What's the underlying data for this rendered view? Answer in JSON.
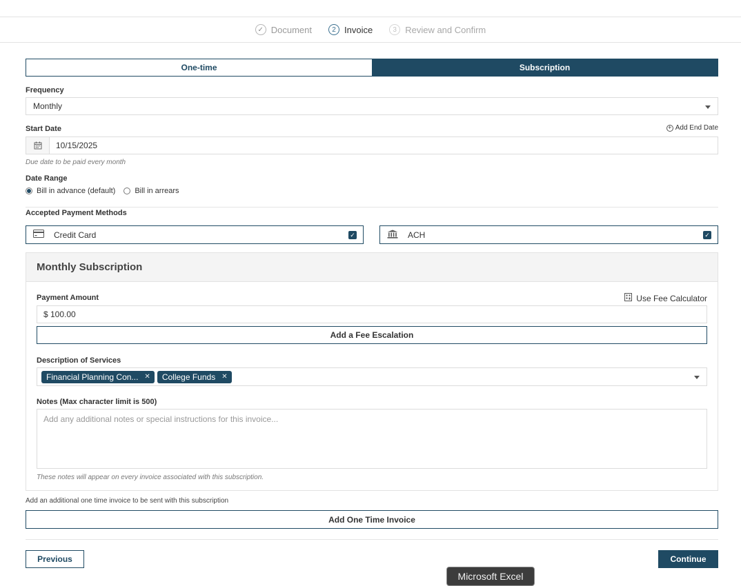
{
  "stepper": {
    "steps": [
      {
        "label": "Document",
        "marker": "✓"
      },
      {
        "label": "Invoice",
        "marker": "2"
      },
      {
        "label": "Review and Confirm",
        "marker": "3"
      }
    ]
  },
  "billing_type": {
    "options": [
      "One-time",
      "Subscription"
    ],
    "selected": "Subscription"
  },
  "frequency": {
    "label": "Frequency",
    "value": "Monthly"
  },
  "start_date": {
    "label": "Start Date",
    "add_end_date": "Add End Date",
    "value": "10/15/2025",
    "hint": "Due date to be paid every month"
  },
  "date_range": {
    "label": "Date Range",
    "options": [
      "Bill in advance (default)",
      "Bill in arrears"
    ],
    "selected": "Bill in advance (default)"
  },
  "payment_methods": {
    "label": "Accepted Payment Methods",
    "items": [
      {
        "label": "Credit Card",
        "icon": "credit-card-icon",
        "checked": true
      },
      {
        "label": "ACH",
        "icon": "bank-icon",
        "checked": true
      }
    ]
  },
  "subscription": {
    "title": "Monthly Subscription",
    "payment_amount_label": "Payment Amount",
    "fee_calculator_label": "Use Fee Calculator",
    "payment_amount_value": "$ 100.00",
    "fee_escalation_label": "Add a Fee Escalation",
    "services_label": "Description of Services",
    "services": [
      "Financial Planning Con...",
      "College Funds"
    ],
    "notes_label": "Notes (Max character limit is 500)",
    "notes_placeholder": "Add any additional notes or special instructions for this invoice...",
    "notes_hint": "These notes will appear on every invoice associated with this subscription."
  },
  "one_time": {
    "description": "Add an additional one time invoice to be sent with this subscription",
    "button_label": "Add One Time Invoice"
  },
  "footer": {
    "previous_label": "Previous",
    "continue_label": "Continue"
  },
  "taskbar_tooltip": "Microsoft Excel",
  "colors": {
    "primary": "#1f4a63",
    "border": "#dcdcdc"
  }
}
